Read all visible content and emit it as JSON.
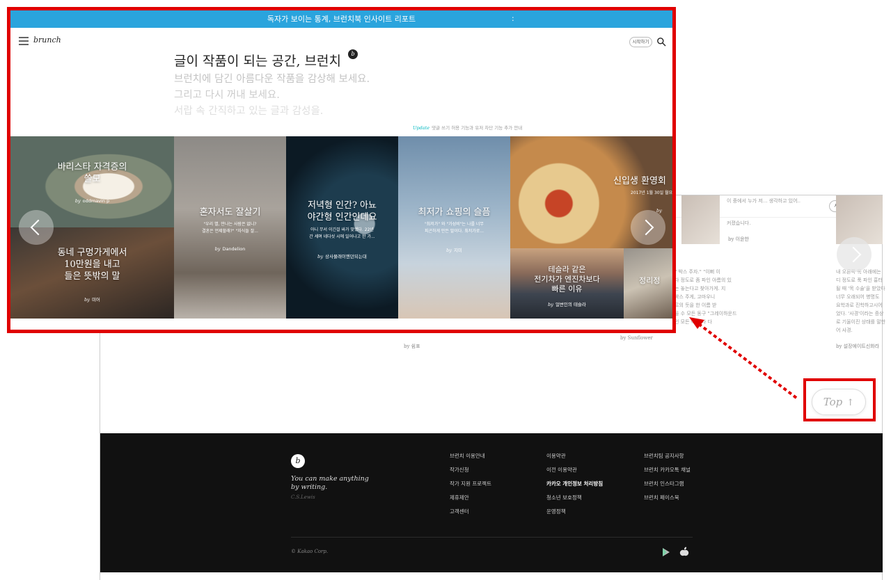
{
  "banner": {
    "text": "독자가 보이는 통계, 브런치북 인사이트 리포트",
    "dots": ":"
  },
  "header": {
    "logo": "brunch",
    "start_label": "시작하기"
  },
  "hero": {
    "headline": "글이 작품이 되는 공간, 브런치",
    "badge": "b",
    "taglines": [
      "브런치에 담긴 아름다운 작품을 감상해 보세요.",
      "그리고 다시 꺼내 보세요.",
      "서랍 속 간직하고 있는 글과 감성을."
    ],
    "update_label": "Update",
    "update_text": "댓글 쓰기 허용 기능과 유저 차단 기능 추가 안내"
  },
  "tiles": [
    {
      "title": "바리스타 자격증의\n쓸모",
      "by": "by",
      "author": "oddmavin p"
    },
    {
      "title": "동네 구멍가게에서\n10만원을 내고\n들은 뜻밖의 말",
      "by": "by",
      "author": "미어"
    },
    {
      "title": "혼자서도 잘살기",
      "desc": "\"우리 별, 만나는 사람은 없니?\n결혼은 언제할래?\" \"자식들 잘...",
      "by": "by",
      "author": "Dandelion"
    },
    {
      "title": "저녁형 인간? 아뇨\n야간형 인간인데요",
      "desc": "아니 무서 이긴걸 싸가 맞했다. 22년\n간 세며 네다섯 시에 일어나고 한 가...",
      "by": "by",
      "author": "상사물래이엔던되는대"
    },
    {
      "title": "최저가 쇼핑의 슬픔",
      "desc": "\"최저가\" 와 \"가성비\"는 나를 너무\n피곤하게 만든 말이다. 최저가로...",
      "by": "by",
      "author": "지미"
    },
    {
      "title": "신입생 환영회",
      "desc": "2017년 1월 30일 월요일...",
      "by": "by",
      "author": ""
    },
    {
      "title": "테슬라 같은\n전기차가 엔진차보다\n빠른 이유",
      "by": "by",
      "author": "얼변인의 테슬라"
    },
    {
      "title": "정리정",
      "by": "",
      "author": ""
    }
  ],
  "back": {
    "start_label": "시작하기",
    "texts": [
      "이 중에서 누가 저... 생각하고 있어..",
      "커졌습니다.",
      "\" 박스 주자.\" \"이뻐 이\n다 정도로 좀 파인 아름의 있\n는 놓는다고 찾아가게. 지\n박스 주게, 고마우니\n르의 듯을 한 이름 받\n을 수 모든 동구 \"그레이하운드\n인 모든 이 있다 다",
      "내 오른쪽 목 아래에는\n디 정도로 푹 파인 흉터\n될 때 '목 수술'을 받았다\n너무 오래되어 병명도 \n요학과로 진학하고시어\n었다. '사경'이라는 증상\n로 기울이진 상태를 말한\n어 사경."
    ],
    "bylines": [
      "by 이윤한",
      "by Sunflower",
      "by 쉼표",
      "by 설장에이트신화라"
    ]
  },
  "top_button": {
    "label": "Top",
    "arrow": "↑"
  },
  "footer": {
    "logo": "b",
    "quote_line1": "You can make anything",
    "quote_line2": "by writing.",
    "quote_author": "C.S.Lewis",
    "col1": [
      "브런치 이용안내",
      "작가신청",
      "작가 지원 프로젝트",
      "제휴제안",
      "고객센터"
    ],
    "col2": [
      "이용약관",
      "이전 이용약관",
      "카카오 개인정보 처리방침",
      "청소년 보호정책",
      "운영정책"
    ],
    "col3": [
      "브런치팀 공지사항",
      "브런치 카카오톡 채널",
      "브런치 인스타그램",
      "브런치 페이스북"
    ],
    "copyright": "© Kakao Corp."
  },
  "colors": {
    "banner": "#2aa4dd",
    "highlight": "#e00000",
    "footer_bg": "#111111",
    "update": "#00b8c0"
  },
  "icons": [
    "menu-icon",
    "search-icon",
    "play-store-icon",
    "apple-icon",
    "arrow-left-icon",
    "arrow-right-icon"
  ]
}
